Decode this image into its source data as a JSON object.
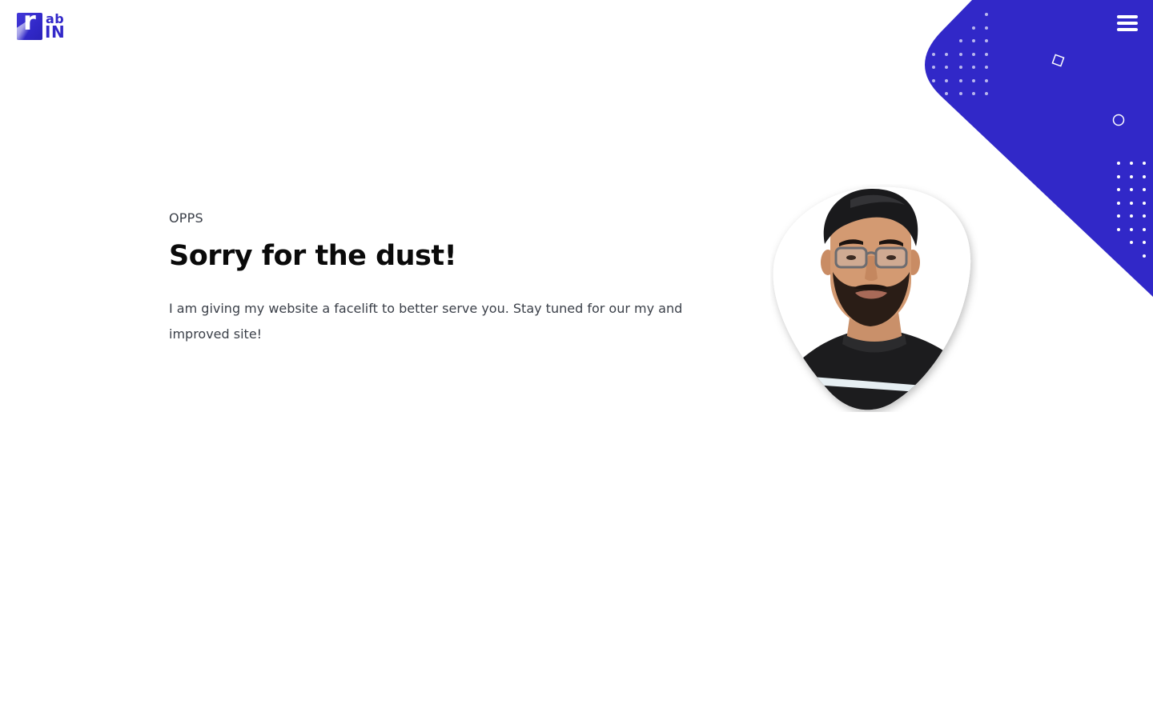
{
  "header": {
    "logo": {
      "letter": "r",
      "top_text": "ab",
      "bottom_text": "IN"
    },
    "menu_icon": "hamburger-icon"
  },
  "main": {
    "eyebrow": "OPPS",
    "title": "Sorry for the dust!",
    "description": "I am giving my website a facelift to better serve you. Stay tuned for our my and improved site!"
  },
  "colors": {
    "accent": "#3128c8",
    "title": "#0a0a0a",
    "body_text": "#3a3f48",
    "background": "#ffffff"
  }
}
